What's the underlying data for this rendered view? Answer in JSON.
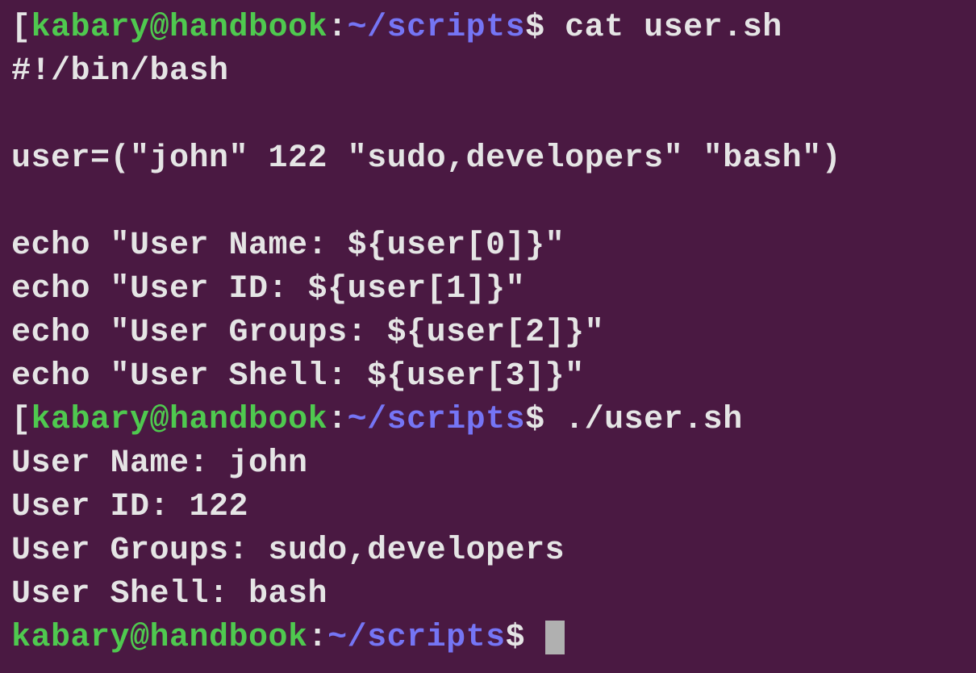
{
  "prompt": {
    "bracket_open": "[",
    "user_host": "kabary@handbook",
    "colon": ":",
    "path": "~/scripts",
    "dollar": "$ "
  },
  "commands": {
    "cat": "cat user.sh",
    "run": "./user.sh"
  },
  "file_content": {
    "shebang": "#!/bin/bash",
    "blank1": "",
    "array_def": "user=(\"john\" 122 \"sudo,developers\" \"bash\")",
    "blank2": "",
    "echo1": "echo \"User Name: ${user[0]}\"",
    "echo2": "echo \"User ID: ${user[1]}\"",
    "echo3": "echo \"User Groups: ${user[2]}\"",
    "echo4": "echo \"User Shell: ${user[3]}\""
  },
  "script_output": {
    "line1": "User Name: john",
    "line2": "User ID: 122",
    "line3": "User Groups: sudo,developers",
    "line4": "User Shell: bash"
  }
}
